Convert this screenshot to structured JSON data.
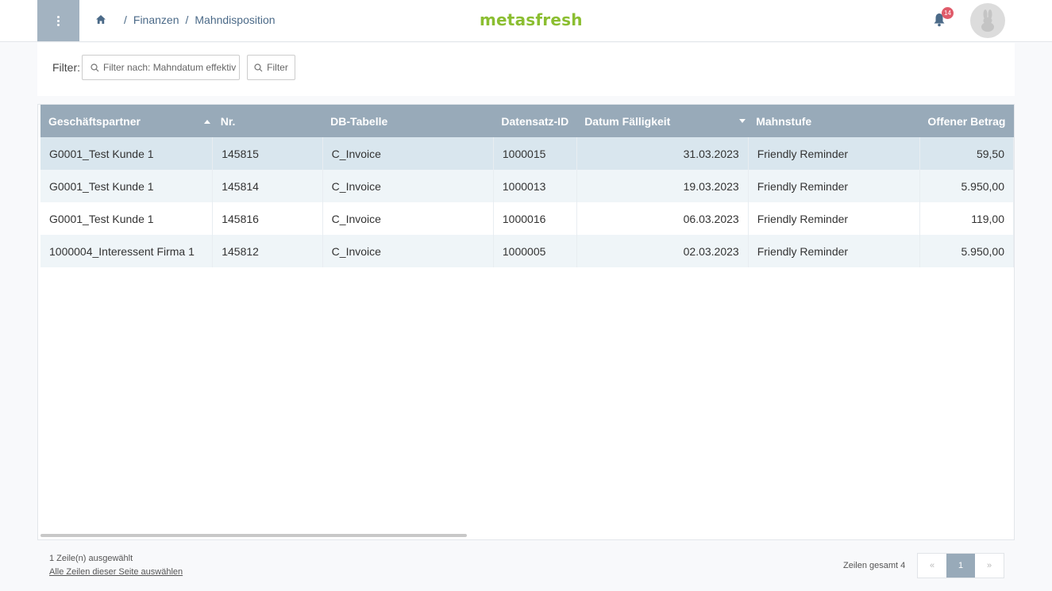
{
  "header": {
    "breadcrumb": [
      "Finanzen",
      "Mahndisposition"
    ],
    "breadcrumb_sep": "/",
    "logo": "metasfresh",
    "notification_count": "14"
  },
  "filter": {
    "label": "Filter:",
    "search_placeholder": "Filter nach: Mahndatum effektiv",
    "button_label": "Filter"
  },
  "table": {
    "columns": [
      "Geschäftspartner",
      "Nr.",
      "DB-Tabelle",
      "Datensatz-ID",
      "Datum Fälligkeit",
      "Mahnstufe",
      "Offener Betrag"
    ],
    "sort": {
      "Geschäftspartner": "asc",
      "Datum Fälligkeit": "desc"
    },
    "rows": [
      [
        "G0001_Test Kunde 1",
        "145815",
        "C_Invoice",
        "1000015",
        "31.03.2023",
        "Friendly Reminder",
        "59,50"
      ],
      [
        "G0001_Test Kunde 1",
        "145814",
        "C_Invoice",
        "1000013",
        "19.03.2023",
        "Friendly Reminder",
        "5.950,00"
      ],
      [
        "G0001_Test Kunde 1",
        "145816",
        "C_Invoice",
        "1000016",
        "06.03.2023",
        "Friendly Reminder",
        "119,00"
      ],
      [
        "1000004_Interessent Firma 1",
        "145812",
        "C_Invoice",
        "1000005",
        "02.03.2023",
        "Friendly Reminder",
        "5.950,00"
      ]
    ],
    "selected_row": 0
  },
  "footer": {
    "selection_info": "1 Zeile(n) ausgewählt",
    "select_all": "Alle Zeilen dieser Seite auswählen",
    "total": "Zeilen gesamt 4",
    "pager": {
      "prev": "«",
      "current": "1",
      "next": "»"
    }
  },
  "colors": {
    "accent": "#98aab9",
    "logo": "#8bbe31",
    "badge": "#e05b6a",
    "link": "#4b6a88"
  }
}
